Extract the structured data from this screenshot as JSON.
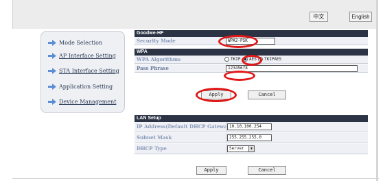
{
  "header": {
    "lang_cn": "中文",
    "lang_en": "English"
  },
  "sidebar": {
    "items": [
      {
        "label": "Mode Selection"
      },
      {
        "label": "AP Interface Setting"
      },
      {
        "label": "STA Interface Setting"
      },
      {
        "label": "Application Setting"
      },
      {
        "label": "Device Management"
      }
    ]
  },
  "goodwe_section": {
    "title": "Goodwe-HF",
    "security_mode_label": "Security Mode",
    "security_mode_value": "WPA2-PSK"
  },
  "wpa_section": {
    "title": "WPA",
    "algorithms_label": "WPA Algorithms",
    "algorithms": [
      "TKIP",
      "AES",
      "TKIPAES"
    ],
    "selected_algorithm": "AES",
    "pass_phrase_label": "Pass Phrase",
    "pass_phrase_value": "12345678"
  },
  "wpa_buttons": {
    "apply": "Apply",
    "cancel": "Cancel"
  },
  "lan_section": {
    "title": "LAN Setup",
    "ip_label": "IP Address(Default DHCP Gateway)",
    "ip_value": "10.10.100.254",
    "mask_label": "Subnet Mask",
    "mask_value": "255.255.255.0",
    "dhcp_label": "DHCP Type",
    "dhcp_value": "Server"
  },
  "lan_buttons": {
    "apply": "Apply",
    "cancel": "Cancel"
  },
  "colors": {
    "section_header": "#2b3344",
    "row_bg": "#eef0f5",
    "annotation": "#e01818"
  }
}
